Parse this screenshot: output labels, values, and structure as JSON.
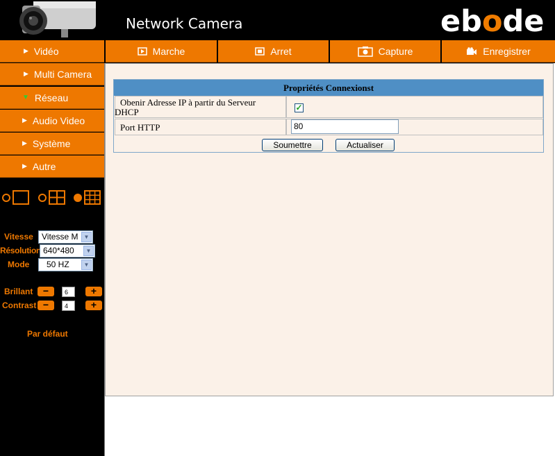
{
  "header": {
    "app_title": "Network Camera",
    "logo_pre": "eb",
    "logo_o": "o",
    "logo_post": "de"
  },
  "toolbar": {
    "items": [
      {
        "label": "Vidéo",
        "icon": "triangle-right-icon"
      },
      {
        "label": "Marche",
        "icon": "play-icon"
      },
      {
        "label": "Arret",
        "icon": "stop-icon"
      },
      {
        "label": "Capture",
        "icon": "camera-icon"
      },
      {
        "label": "Enregistrer",
        "icon": "video-camera-icon"
      }
    ]
  },
  "sidebar": {
    "items": [
      {
        "label": "Multi Camera",
        "icon": "triangle-right-icon"
      },
      {
        "label": "Réseau",
        "icon": "triangle-down-icon",
        "expanded": true
      },
      {
        "label": "Audio Video",
        "icon": "triangle-right-icon"
      },
      {
        "label": "Système",
        "icon": "triangle-right-icon"
      },
      {
        "label": "Autre",
        "icon": "triangle-right-icon"
      }
    ],
    "layout_selected": 3,
    "controls": {
      "vitesse_label": "Vitesse",
      "vitesse_value": "Vitesse M",
      "resolution_label": "Résolution",
      "resolution_value": "640*480",
      "mode_label": "Mode",
      "mode_value": "50 HZ",
      "brillant_label": "Brillant",
      "brillant_value": "6",
      "contrast_label": "Contrast",
      "contrast_value": "4",
      "minus": "−",
      "plus": "+"
    },
    "default_label": "Par défaut"
  },
  "props": {
    "title": "Propriétés Connexionst",
    "dhcp_label": "Obenir Adresse IP à partir du Serveur DHCP",
    "dhcp_checked": true,
    "dhcp_check_glyph": "✓",
    "port_label": "Port HTTP",
    "port_value": "80",
    "submit_label": "Soumettre",
    "refresh_label": "Actualiser"
  },
  "colors": {
    "accent": "#ee7800",
    "panel_bg": "#fbf1e8",
    "title_bar": "#4f8fc5"
  }
}
